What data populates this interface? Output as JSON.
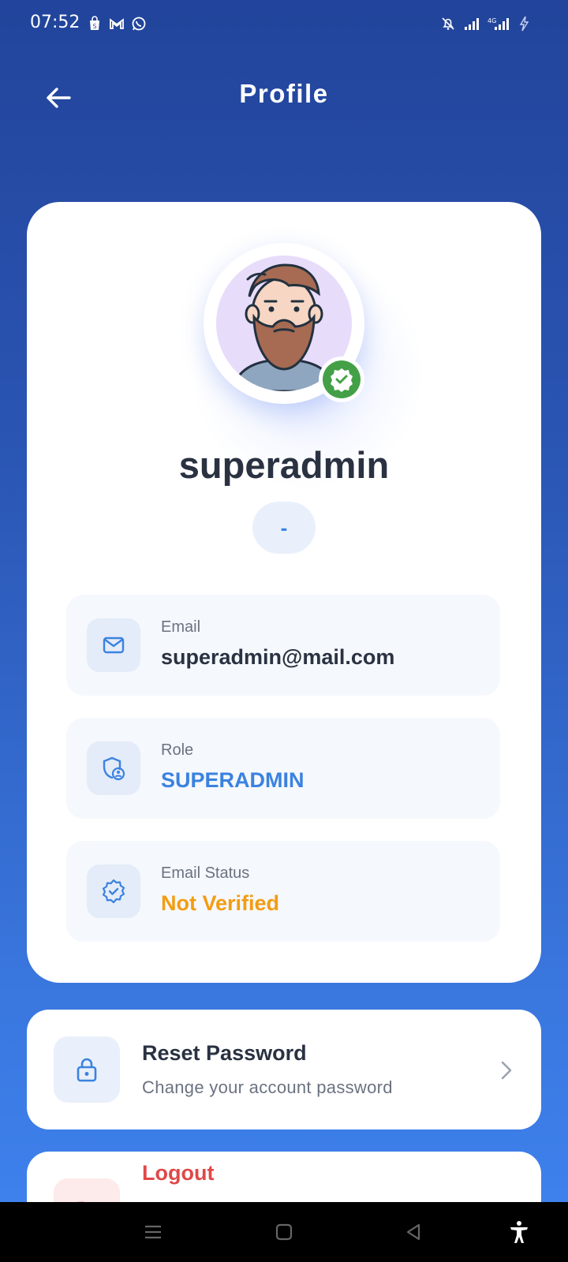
{
  "status_bar": {
    "time": "07:52",
    "left_icons": [
      "shopping-bag-icon",
      "gmail-icon",
      "whatsapp-icon"
    ],
    "right_icons": [
      "bell-off-icon",
      "signal-icon",
      "signal-4g-icon",
      "charging-icon"
    ]
  },
  "header": {
    "title": "Profile",
    "back_icon": "arrow-left-icon"
  },
  "profile": {
    "username": "superadmin",
    "subtitle": "-",
    "verified_badge_icon": "verified-check-icon",
    "info": [
      {
        "label": "Email",
        "value": "superadmin@mail.com",
        "icon": "mail-icon",
        "value_color": "#2a3242"
      },
      {
        "label": "Role",
        "value": "SUPERADMIN",
        "icon": "shield-user-icon",
        "value_color": "#3b82e0"
      },
      {
        "label": "Email Status",
        "value": "Not Verified",
        "icon": "badge-check-icon",
        "value_color": "#f39c12"
      }
    ]
  },
  "actions": {
    "reset_password": {
      "title": "Reset Password",
      "subtitle": "Change your account password",
      "icon": "lock-icon"
    },
    "logout": {
      "title": "Logout",
      "icon": "logout-icon"
    }
  },
  "nav_bar": {
    "icons": [
      "menu-icon",
      "home-square-icon",
      "back-triangle-icon",
      "accessibility-icon"
    ]
  },
  "colors": {
    "accent": "#3b82e0",
    "success": "#43a047",
    "warning": "#f39c12",
    "danger": "#e04848"
  }
}
